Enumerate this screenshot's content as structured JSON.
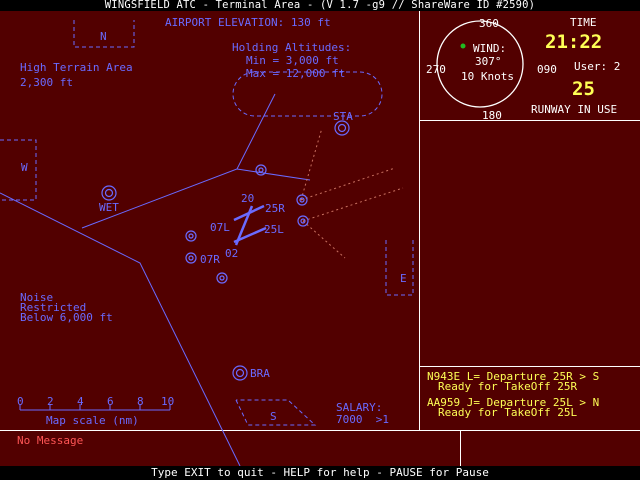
{
  "title": "WINGSFIELD ATC - Terminal Area - (V 1.7 -g9 // ShareWare ID #2590)",
  "map": {
    "elevation": "AIRPORT ELEVATION: 130 ft",
    "holding": [
      "Holding Altitudes:",
      "Min = 3,000 ft",
      "Max = 12,000 ft"
    ],
    "terrain": [
      "High Terrain Area",
      "2,300 ft"
    ],
    "noise": [
      "Noise",
      "Restricted",
      "Below 6,000 ft"
    ],
    "sectors": {
      "n": "N",
      "w": "W",
      "e": "E",
      "s": "S"
    },
    "fixes": {
      "sta": "STA",
      "wet": "WET",
      "bra": "BRA"
    },
    "runways": {
      "r07l": "07L",
      "r07r": "07R",
      "r20": "20",
      "r25r": "25R",
      "r25l": "25L",
      "r02": "02"
    },
    "scale": {
      "ticks": [
        "0",
        "2",
        "4",
        "6",
        "8",
        "10"
      ],
      "label": "Map scale (nm)"
    },
    "salary": {
      "label": "SALARY:",
      "value": "7000  >1"
    }
  },
  "wind": {
    "label": "WIND:",
    "direction": "307°",
    "speed": "10 Knots",
    "compass": {
      "n": "360",
      "e": "090",
      "s": "180",
      "w": "270"
    }
  },
  "time": {
    "label": "TIME",
    "value": "21:22"
  },
  "user": {
    "label": "User: 2"
  },
  "runway_in_use": {
    "value": "25",
    "label": "RUNWAY IN USE"
  },
  "flights": [
    {
      "line1": "N943E L= Departure 25R > S",
      "line2": "Ready for TakeOff 25R"
    },
    {
      "line1": "AA959 J= Departure 25L > N",
      "line2": "Ready for TakeOff 25L"
    }
  ],
  "message": "No Message",
  "footer": "Type EXIT to quit - HELP for help - PAUSE for Pause",
  "colors": {
    "background": "#520000",
    "map": "#6a6aff",
    "panel_border": "#ffffff",
    "text_accent": "#ffff55",
    "message": "#ff5555",
    "route": "#c87060"
  }
}
